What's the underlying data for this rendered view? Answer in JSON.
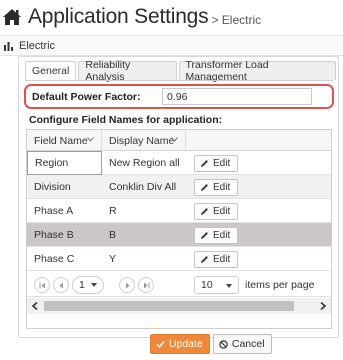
{
  "header": {
    "title": "Application Settings",
    "subtitle": "> Electric",
    "icon": "home-icon"
  },
  "panel": {
    "title": "Electric",
    "icon": "bar-chart-icon"
  },
  "tabs": [
    {
      "label": "General",
      "active": true
    },
    {
      "label": "Reliability Analysis",
      "active": false
    },
    {
      "label": "Transformer Load Management",
      "active": false
    }
  ],
  "default_power_factor": {
    "label": "Default Power Factor:",
    "value": "0.96"
  },
  "config_title": "Configure Field Names for application:",
  "grid": {
    "columns": [
      "Field Name",
      "Display Name"
    ],
    "rows": [
      {
        "field": "Region",
        "display": "New Region all",
        "action": "Edit"
      },
      {
        "field": "Division",
        "display": "Conklin Div All",
        "action": "Edit"
      },
      {
        "field": "Phase A",
        "display": "R",
        "action": "Edit"
      },
      {
        "field": "Phase B",
        "display": "B",
        "action": "Edit"
      },
      {
        "field": "Phase C",
        "display": "Y",
        "action": "Edit"
      }
    ],
    "selected_row": 3
  },
  "pager": {
    "current_page": "1",
    "page_size": "10",
    "page_size_label": "items per page"
  },
  "actions": {
    "update": "Update",
    "cancel": "Cancel"
  },
  "colors": {
    "accent": "#f0883a",
    "highlight_border": "#d9534f",
    "selected_row": "#cbc7c8"
  }
}
